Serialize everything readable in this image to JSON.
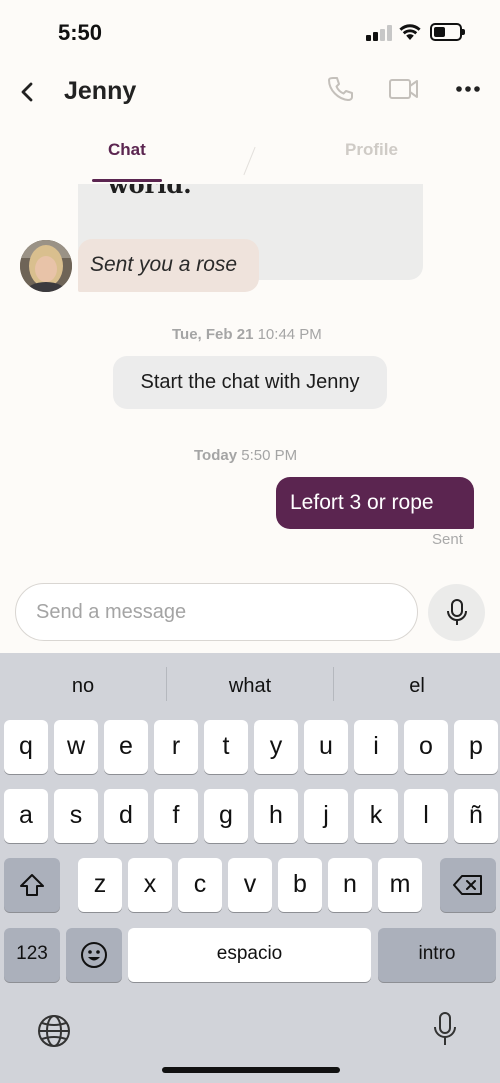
{
  "status_bar": {
    "time": "5:50"
  },
  "header": {
    "contact_name": "Jenny",
    "tabs": [
      {
        "label": "Chat",
        "active": true
      },
      {
        "label": "Profile",
        "active": false
      }
    ]
  },
  "messages": {
    "previous_card_snippet": "world.",
    "rose_message": "Sent you a rose",
    "timestamp_1": {
      "day": "Tue, Feb 21",
      "time": "10:44 PM"
    },
    "system_message": "Start the chat with Jenny",
    "timestamp_2": {
      "day": "Today",
      "time": "5:50 PM"
    },
    "outgoing_message": "Lefort 3 or rope",
    "outgoing_status": "Sent"
  },
  "composer": {
    "placeholder": "Send a message"
  },
  "keyboard": {
    "suggestions": [
      "no",
      "what",
      "el"
    ],
    "row1": [
      "q",
      "w",
      "e",
      "r",
      "t",
      "y",
      "u",
      "i",
      "o",
      "p"
    ],
    "row2": [
      "a",
      "s",
      "d",
      "f",
      "g",
      "h",
      "j",
      "k",
      "l",
      "ñ"
    ],
    "row3": [
      "z",
      "x",
      "c",
      "v",
      "b",
      "n",
      "m"
    ],
    "numbers_key": "123",
    "space_key": "espacio",
    "return_key": "intro"
  },
  "colors": {
    "accent": "#5b2550",
    "rose_bubble": "#efe3dc",
    "system_bubble": "#ececec",
    "background": "#fdfbf8",
    "keyboard_bg": "#d1d3d9"
  }
}
